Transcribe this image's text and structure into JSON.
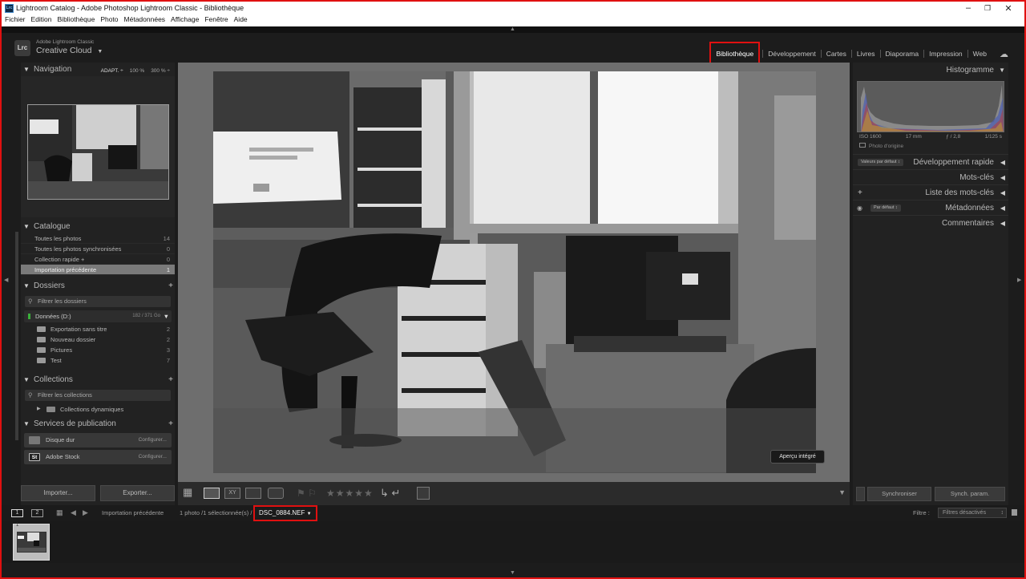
{
  "window": {
    "app_icon": "Lrc",
    "title": "Lightroom Catalog - Adobe Photoshop Lightroom Classic - Bibliothèque",
    "minimize_icon": "minimize-icon",
    "restore_icon": "restore-icon",
    "close_icon": "close-icon"
  },
  "menu": [
    "Fichier",
    "Edition",
    "Bibliothèque",
    "Photo",
    "Métadonnées",
    "Affichage",
    "Fenêtre",
    "Aide"
  ],
  "identity": {
    "logo": "Lrc",
    "small": "Adobe Lightroom Classic",
    "big": "Creative Cloud",
    "caret": "▼"
  },
  "modules": {
    "items": [
      "Bibliothèque",
      "Développement",
      "Cartes",
      "Livres",
      "Diaporama",
      "Impression",
      "Web"
    ],
    "active": "Bibliothèque"
  },
  "navigation": {
    "title": "Navigation",
    "zoom": [
      "ADAPT. ÷",
      "100 %",
      "300 % ÷"
    ]
  },
  "catalogue": {
    "title": "Catalogue",
    "rows": [
      {
        "label": "Toutes les photos",
        "count": "14"
      },
      {
        "label": "Toutes les photos synchronisées",
        "count": "0"
      },
      {
        "label": "Collection rapide +",
        "count": "0"
      },
      {
        "label": "Importation précédente",
        "count": "1"
      }
    ]
  },
  "dossiers": {
    "title": "Dossiers",
    "filter": "Filtrer les dossiers",
    "drive": {
      "label": "Données (D:)",
      "size": "182 / 371 Go"
    },
    "folders": [
      {
        "label": "Exportation sans titre",
        "count": "2"
      },
      {
        "label": "Nouveau dossier",
        "count": "2"
      },
      {
        "label": "Pictures",
        "count": "3"
      },
      {
        "label": "Test",
        "count": "7"
      }
    ]
  },
  "collections": {
    "title": "Collections",
    "filter": "Filtrer les collections",
    "smart": "Collections dynamiques"
  },
  "publish": {
    "title": "Services de publication",
    "services": [
      {
        "label": "Disque dur",
        "icon": "",
        "action": "Configurer..."
      },
      {
        "label": "Adobe Stock",
        "icon": "St",
        "action": "Configurer..."
      }
    ]
  },
  "buttons": {
    "import": "Importer...",
    "export": "Exporter..."
  },
  "preview": {
    "badge": "Aperçu intégré"
  },
  "histogram": {
    "title": "Histogramme",
    "iso": "ISO 1600",
    "focal": "17 mm",
    "aperture": "ƒ / 2,8",
    "shutter": "1/125 s",
    "original": "Photo d'origine"
  },
  "right_sections": {
    "quick_develop": "Développement rapide",
    "quick_preset": "Valeurs par défaut",
    "keywords": "Mots-clés",
    "keyword_list": "Liste des mots-clés",
    "metadata": "Métadonnées",
    "metadata_preset": "Par défaut",
    "comments": "Commentaires"
  },
  "sync": {
    "sync": "Synchroniser",
    "sync_settings": "Synch. param."
  },
  "filmstrip": {
    "page1": "1",
    "page2": "2",
    "source": "Importation précédente",
    "info": "1 photo /1 sélectionnée(s) /",
    "filename": "DSC_0884.NEF",
    "filter_label": "Filtre :",
    "filter_value": "Filtres désactivés",
    "thumb_index": "1"
  },
  "colors": {
    "highlight": "#e01010",
    "panel_bg": "#222222",
    "selected_row": "#7a7a7a"
  }
}
